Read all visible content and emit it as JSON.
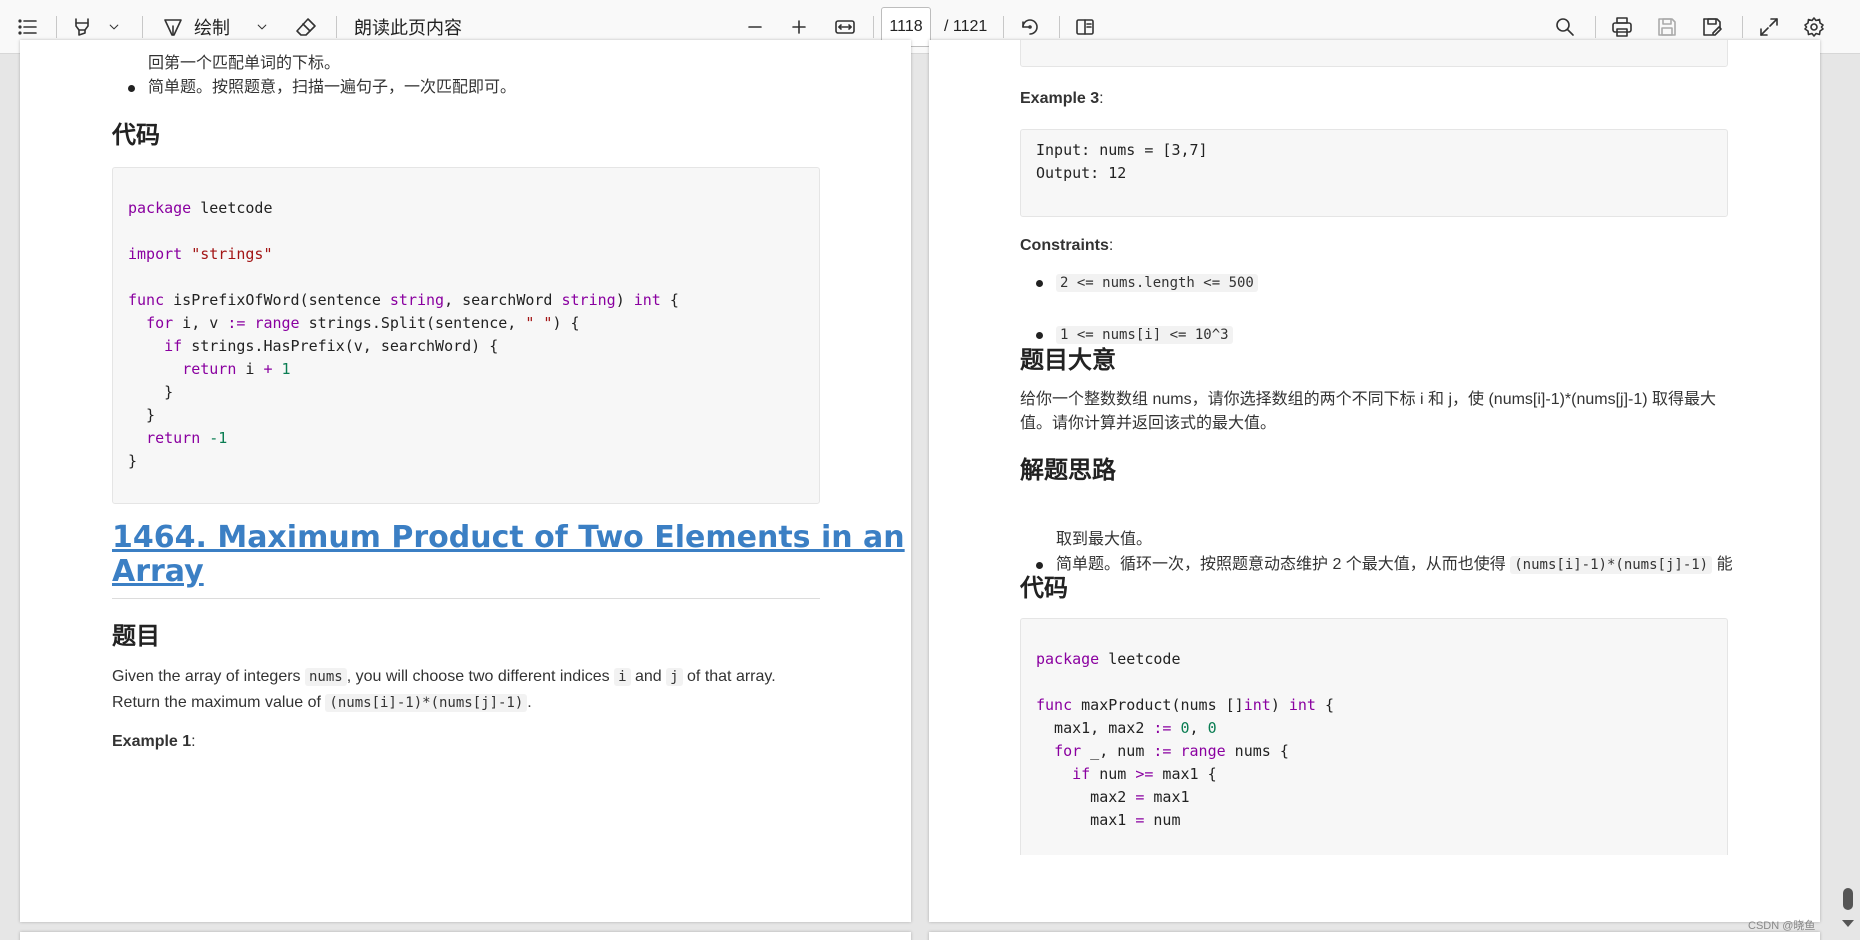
{
  "toolbar": {
    "draw_label": "绘制",
    "read_aloud_label": "朗读此页内容",
    "page_current": "1118",
    "page_total": "/ 1121"
  },
  "left_page": {
    "top_line_1": "回第一个匹配单词的下标。",
    "top_bullet": "简单题。按照题意，扫描一遍句子，一次匹配即可。",
    "code_heading": "代码",
    "code_lines": [
      "package leetcode",
      "",
      "import \"strings\"",
      "",
      "func isPrefixOfWord(sentence string, searchWord string) int {",
      "  for i, v := range strings.Split(sentence, \" \") {",
      "    if strings.HasPrefix(v, searchWord) {",
      "      return i + 1",
      "    }",
      "  }",
      "  return -1",
      "}"
    ],
    "problem_title_line1": "1464. Maximum Product of Two Elements in an",
    "problem_title_line2": "Array",
    "problem_heading": "题目",
    "desc_part1": "Given the array of integers ",
    "desc_code1": "nums",
    "desc_part2": ", you will choose two different indices ",
    "desc_code2": "i",
    "desc_part3": " and ",
    "desc_code3": "j",
    "desc_part4": " of that array.",
    "desc_line2_part1": "Return the maximum value of ",
    "desc_line2_code": "(nums[i]-1)*(nums[j]-1)",
    "desc_line2_part2": ".",
    "example1_label": "Example 1",
    "example1_colon": ":"
  },
  "right_page": {
    "example3_label": "Example 3",
    "example3_colon": ":",
    "example3_lines": [
      "Input: nums = [3,7]",
      "Output: 12"
    ],
    "constraints_label": "Constraints",
    "constraints_colon": ":",
    "constraints": [
      "2 <= nums.length <= 500",
      "1 <= nums[i] <= 10^3"
    ],
    "meaning_heading": "题目大意",
    "meaning_line1": "给你一个整数数组 nums，请你选择数组的两个不同下标 i 和 j，使 (nums[i]-1)*(nums[j]-1) 取得最大",
    "meaning_line2": "值。请你计算并返回该式的最大值。",
    "idea_heading": "解题思路",
    "idea_part1": "简单题。循环一次，按照题意动态维护 2 个最大值，从而也使得 ",
    "idea_code": "(nums[i]-1)*(nums[j]-1)",
    "idea_part2": " 能",
    "idea_line2": "取到最大值。",
    "code_heading": "代码",
    "code_lines": [
      "package leetcode",
      "",
      "func maxProduct(nums []int) int {",
      "  max1, max2 := 0, 0",
      "  for _, num := range nums {",
      "    if num >= max1 {",
      "      max2 = max1",
      "      max1 = num"
    ]
  },
  "watermark": "CSDN @晓鱼",
  "icons": {
    "list": "list-icon",
    "highlighter": "highlighter-icon",
    "pen": "pen-icon",
    "eraser": "eraser-icon",
    "zoom_out": "minus-icon",
    "zoom_in": "plus-icon",
    "fit_width": "fit-width-icon",
    "rotate": "rotate-icon",
    "page_view": "page-view-icon",
    "search": "search-icon",
    "print": "print-icon",
    "save": "save-icon",
    "save_as": "save-as-icon",
    "fullscreen": "expand-icon",
    "settings": "gear-icon"
  }
}
